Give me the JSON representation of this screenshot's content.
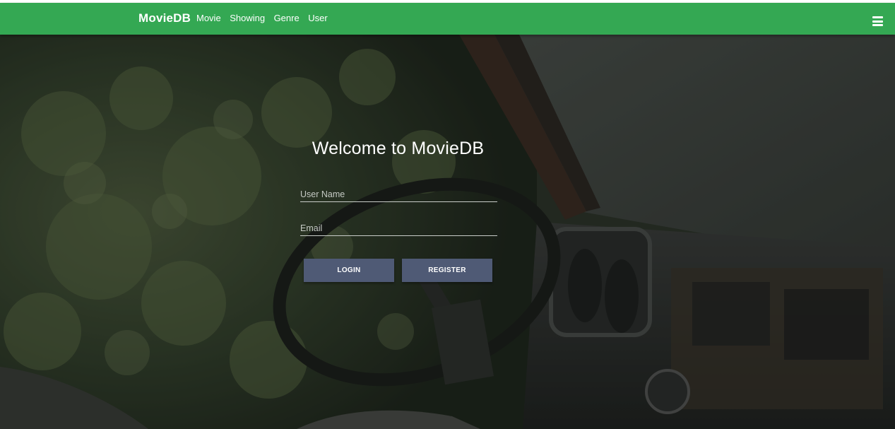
{
  "navbar": {
    "brand": "MovieDB",
    "links": [
      "Movie",
      "Showing",
      "Genre",
      "User"
    ],
    "menu_icon": "hamburger-menu-icon",
    "color": "#34a853"
  },
  "hero": {
    "title": "Welcome to MovieDB",
    "username_placeholder": "User Name",
    "username_value": "",
    "email_placeholder": "Email",
    "email_value": "",
    "login_label": "LOGIN",
    "register_label": "REGISTER",
    "button_color": "#4f5a75"
  }
}
